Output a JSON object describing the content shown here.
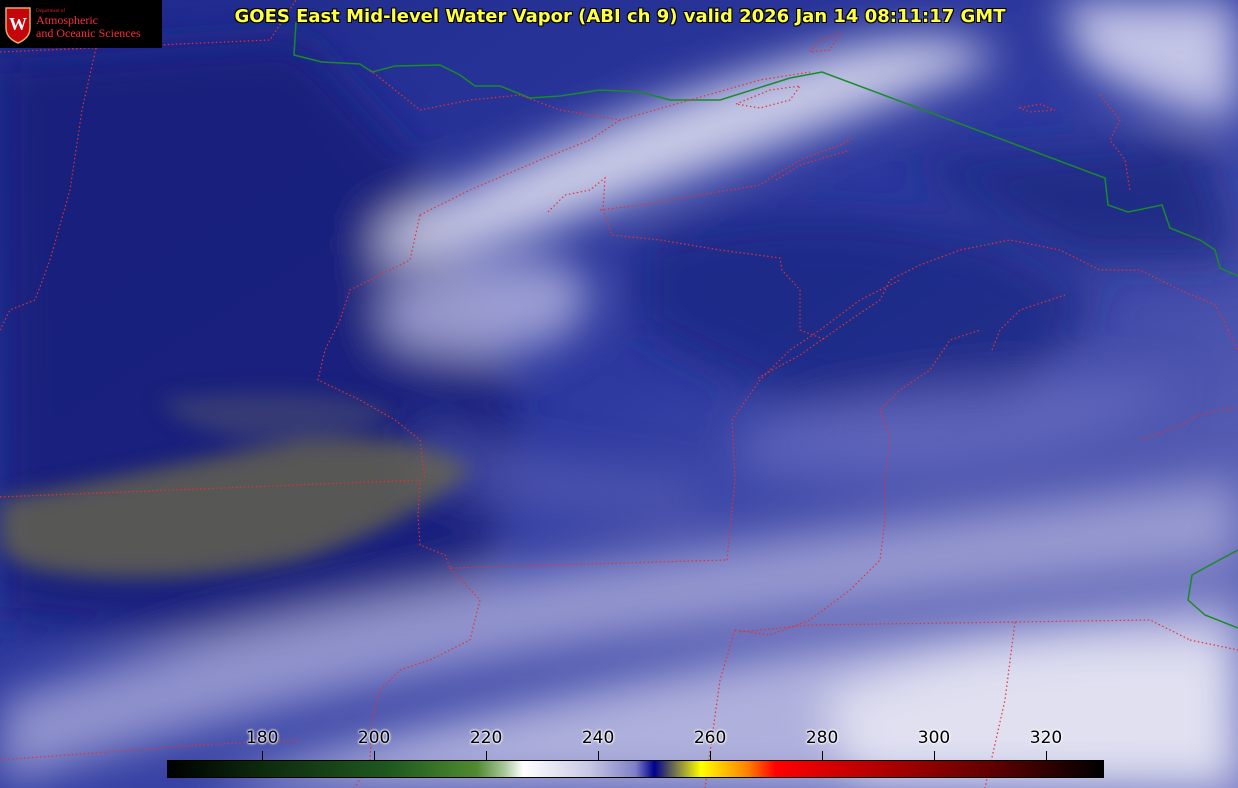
{
  "title": "GOES East Mid-level Water Vapor (ABI ch 9)  valid 2026 Jan 14 08:11:17 GMT",
  "logo": {
    "line1": "Department of",
    "line2": "Atmospheric",
    "line3": "and Oceanic Sciences",
    "seal_letter": "W"
  },
  "colorbar": {
    "unit": "",
    "ticks": [
      "180",
      "200",
      "220",
      "240",
      "260",
      "280",
      "300",
      "320"
    ],
    "range": [
      163,
      330
    ]
  },
  "colors": {
    "state_borders": "#e83030",
    "country_border": "#1a8a2a",
    "title_text": "#ffff44",
    "vapor_dark": "#15207d",
    "vapor_light": "#dcdcf0",
    "dry_slot": "#6d6a4a"
  }
}
